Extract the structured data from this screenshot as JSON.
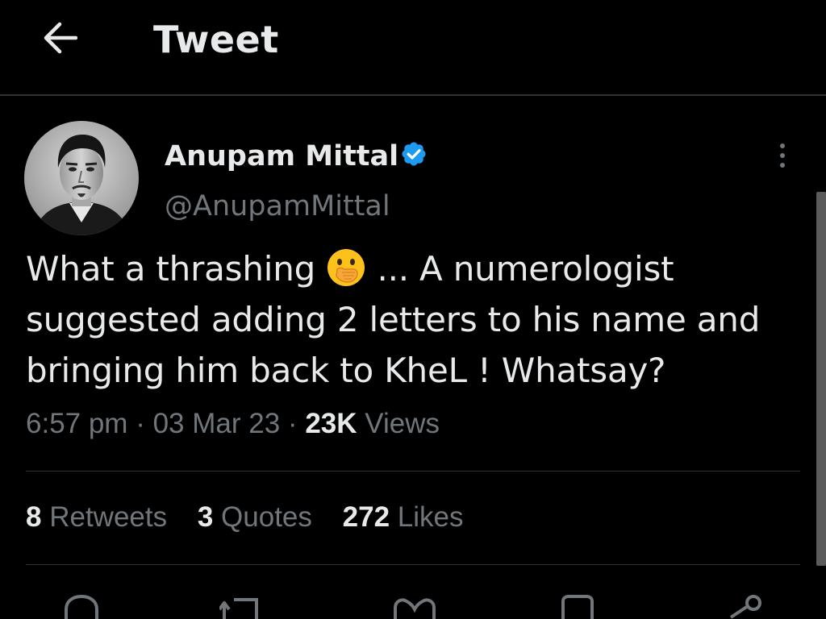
{
  "header": {
    "title": "Tweet",
    "back_icon": "arrow-left-icon"
  },
  "tweet": {
    "author": {
      "display_name": "Anupam Mittal",
      "handle": "@AnupamMittal",
      "verified": true,
      "verified_color": "#1d9bf0"
    },
    "text_part1": "What a thrashing ",
    "emoji": "face-with-hand-over-mouth-emoji",
    "text_part2": " ... A numerologist suggested adding 2 letters to his name and bringing him back to KheL ! Whatsay?",
    "time": "6:57 pm",
    "date": "03 Mar 23",
    "separator": "·",
    "views_count": "23K",
    "views_label": "Views"
  },
  "stats": {
    "retweets_count": "8",
    "retweets_label": "Retweets",
    "quotes_count": "3",
    "quotes_label": "Quotes",
    "likes_count": "272",
    "likes_label": "Likes"
  },
  "actions": [
    "reply-icon",
    "retweet-icon",
    "like-icon",
    "bookmark-icon",
    "share-icon"
  ],
  "colors": {
    "background": "#000000",
    "text": "#e7e9ea",
    "secondary": "#71767b",
    "divider": "#2f3336",
    "accent": "#1d9bf0"
  }
}
